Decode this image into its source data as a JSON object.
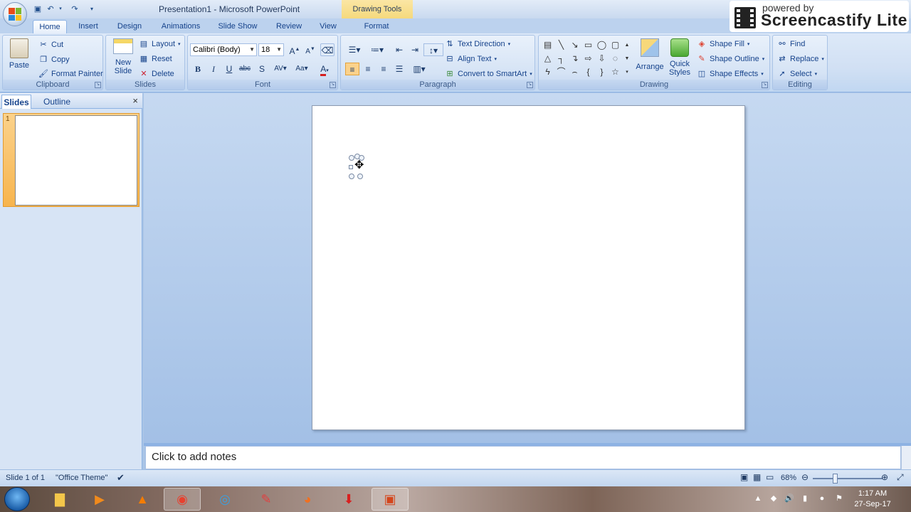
{
  "title_bar": {
    "title": "Presentation1 - Microsoft PowerPoint",
    "contextual_tab_group": "Drawing Tools"
  },
  "screencastify": {
    "powered": "powered by",
    "name": "Screencastify Lite"
  },
  "tabs": [
    "Home",
    "Insert",
    "Design",
    "Animations",
    "Slide Show",
    "Review",
    "View",
    "Format"
  ],
  "ribbon": {
    "clipboard": {
      "paste": "Paste",
      "cut": "Cut",
      "copy": "Copy",
      "format_painter": "Format Painter",
      "label": "Clipboard"
    },
    "slides": {
      "new_slide_1": "New",
      "new_slide_2": "Slide",
      "layout": "Layout",
      "reset": "Reset",
      "delete": "Delete",
      "label": "Slides"
    },
    "font": {
      "font_name": "Calibri (Body)",
      "font_size": "18",
      "label": "Font"
    },
    "paragraph": {
      "text_direction": "Text Direction",
      "align_text": "Align Text",
      "convert_smartart": "Convert to SmartArt",
      "label": "Paragraph"
    },
    "drawing": {
      "arrange": "Arrange",
      "quick_styles_1": "Quick",
      "quick_styles_2": "Styles",
      "shape_fill": "Shape Fill",
      "shape_outline": "Shape Outline",
      "shape_effects": "Shape Effects",
      "label": "Drawing"
    },
    "editing": {
      "find": "Find",
      "replace": "Replace",
      "select": "Select",
      "label": "Editing"
    }
  },
  "left_pane": {
    "tab_slides": "Slides",
    "tab_outline": "Outline",
    "close": "×",
    "slide_number": "1"
  },
  "notes": {
    "placeholder": "Click to add notes"
  },
  "status_bar": {
    "slide_info": "Slide 1 of 1",
    "theme": "\"Office Theme\"",
    "zoom": "68%"
  },
  "taskbar": {
    "time": "1:17 AM",
    "date": "27-Sep-17"
  },
  "colors": {
    "ribbon_bg": "#d1e0f4",
    "accent": "#15428b",
    "selected_thumb": "#f7b44d"
  }
}
